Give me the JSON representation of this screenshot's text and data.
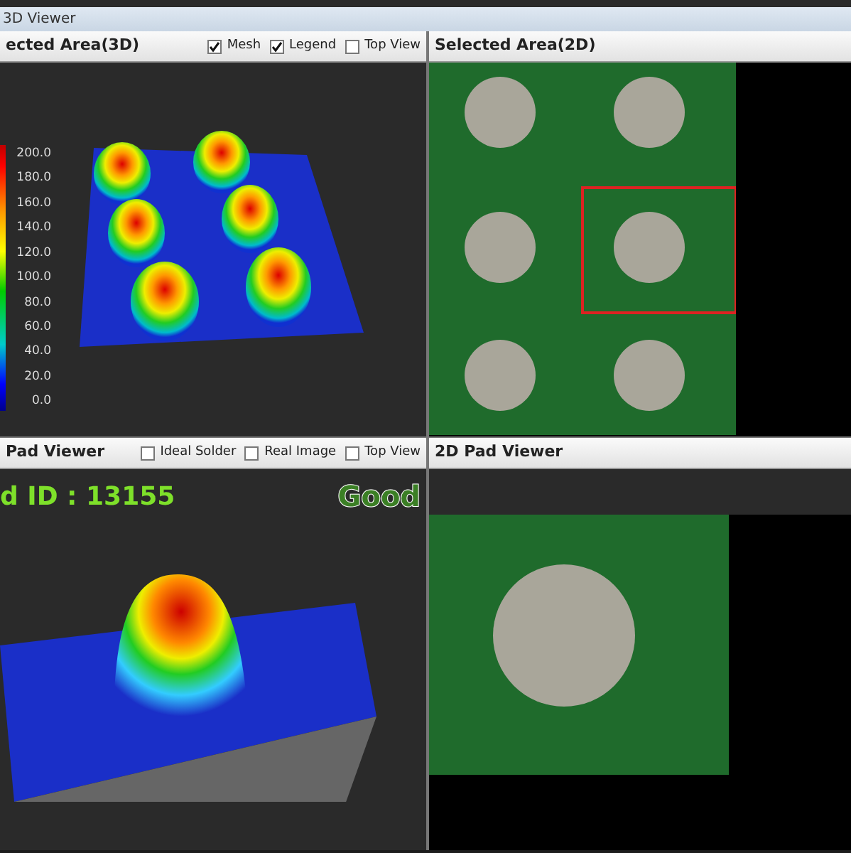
{
  "window": {
    "title": "3D Viewer"
  },
  "selected_area_3d": {
    "title": "ected Area(3D)",
    "options": [
      {
        "label": "Mesh",
        "checked": true
      },
      {
        "label": "Legend",
        "checked": true
      },
      {
        "label": "Top View",
        "checked": false
      }
    ],
    "legend_ticks": [
      "200.0",
      "180.0",
      "160.0",
      "140.0",
      "120.0",
      "100.0",
      "80.0",
      "60.0",
      "40.0",
      "20.0",
      "0.0"
    ]
  },
  "selected_area_2d": {
    "title": "Selected Area(2D)"
  },
  "pad_viewer_3d": {
    "title": "Pad Viewer",
    "options": [
      {
        "label": "Ideal Solder",
        "checked": false
      },
      {
        "label": "Real Image",
        "checked": false
      },
      {
        "label": "Top View",
        "checked": false
      }
    ],
    "pad_id": "d ID : 13155",
    "result": "Good"
  },
  "pad_viewer_2d": {
    "title": "2D Pad Viewer"
  }
}
